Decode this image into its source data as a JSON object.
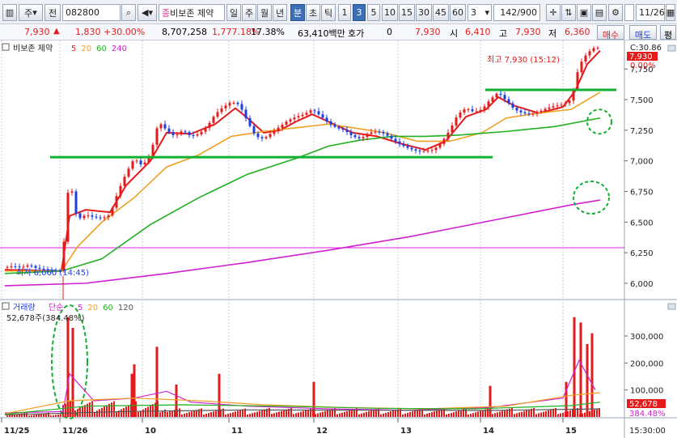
{
  "toolbar": {
    "market_label": "주",
    "period_label": "전",
    "code": "082800",
    "stock_name": "비보존 제약",
    "stock_badge": "종",
    "periods": [
      "일",
      "주",
      "월",
      "년",
      "분",
      "초",
      "틱"
    ],
    "selected_period": "분",
    "intervals": [
      "1",
      "3",
      "5",
      "10",
      "15",
      "30",
      "45",
      "60"
    ],
    "selected_interval": "3",
    "interval_select": "3",
    "count": "142",
    "count_total": "/900",
    "date": "11/26"
  },
  "quote": {
    "price": "7,930",
    "change": "1,830",
    "change_pct": "+30.00%",
    "volume": "8,707,258",
    "volume_pct": "1,777.18%",
    "turnover": "17.38%",
    "amount": "63,410백만",
    "hoga_label": "호가",
    "hoga_value": "0",
    "hoga_price": "7,930",
    "open_label": "시",
    "open": "6,410",
    "high_label": "고",
    "high": "7,930",
    "low_label": "저",
    "low": "6,360",
    "buy_button": "매수",
    "sell_button": "매도",
    "eval_button": "평"
  },
  "chart_data": {
    "type": "candlestick",
    "price_panel": {
      "title": "비보존 제약",
      "ma_labels": [
        {
          "label": "5",
          "color": "#e51b1b"
        },
        {
          "label": "20",
          "color": "#f0a020"
        },
        {
          "label": "60",
          "color": "#20b020"
        },
        {
          "label": "240",
          "color": "#d020d0"
        }
      ],
      "ylim": [
        5900,
        7950
      ],
      "y_ticks": [
        6000,
        6250,
        6500,
        6750,
        7000,
        7250,
        7500,
        7750
      ],
      "y_tick_labels": [
        "6,000",
        "6,250",
        "6,500",
        "6,750",
        "7,000",
        "7,250",
        "7,500",
        "7,750"
      ],
      "top_right_label": "C:30.86",
      "current_price_label": "7,930",
      "current_pct_label": "0.00%",
      "high_annotation": "최고 7,930 (15:12)",
      "low_annotation": "최저 6,060 (14:45)",
      "support_line_1": 7030,
      "support_line_2": 7580,
      "reference_line": 6290
    },
    "volume_panel": {
      "title": "거래량",
      "unit_label": "단순",
      "ma_labels": [
        {
          "label": "5",
          "color": "#d020d0"
        },
        {
          "label": "20",
          "color": "#f0a020"
        },
        {
          "label": "60",
          "color": "#20b020"
        },
        {
          "label": "120",
          "color": "#555555"
        }
      ],
      "info": "52,678주(384.48%)",
      "ylim": [
        0,
        390000
      ],
      "y_ticks": [
        100000,
        200000,
        300000
      ],
      "y_tick_labels": [
        "100,000",
        "200,000",
        "300,000"
      ],
      "current_volume_label": "52,678",
      "current_pct_label": "384.48%"
    },
    "x_labels": [
      "11/25",
      "11/26",
      "10",
      "11",
      "12",
      "13",
      "14",
      "15"
    ],
    "time_label": "15:30:00",
    "price_path": [
      [
        0,
        6130
      ],
      [
        10,
        6140
      ],
      [
        20,
        6130
      ],
      [
        30,
        6150
      ],
      [
        40,
        6120
      ],
      [
        55,
        6110
      ],
      [
        70,
        6100
      ],
      [
        80,
        6900
      ],
      [
        85,
        6650
      ],
      [
        90,
        6520
      ],
      [
        100,
        6560
      ],
      [
        110,
        6540
      ],
      [
        120,
        6530
      ],
      [
        130,
        6560
      ],
      [
        140,
        6750
      ],
      [
        150,
        6900
      ],
      [
        160,
        7020
      ],
      [
        170,
        6960
      ],
      [
        180,
        7050
      ],
      [
        190,
        7320
      ],
      [
        200,
        7250
      ],
      [
        210,
        7200
      ],
      [
        220,
        7250
      ],
      [
        230,
        7200
      ],
      [
        240,
        7220
      ],
      [
        250,
        7280
      ],
      [
        260,
        7380
      ],
      [
        270,
        7440
      ],
      [
        280,
        7480
      ],
      [
        290,
        7460
      ],
      [
        300,
        7320
      ],
      [
        310,
        7200
      ],
      [
        320,
        7180
      ],
      [
        330,
        7230
      ],
      [
        340,
        7280
      ],
      [
        350,
        7330
      ],
      [
        360,
        7360
      ],
      [
        370,
        7380
      ],
      [
        380,
        7420
      ],
      [
        390,
        7370
      ],
      [
        400,
        7310
      ],
      [
        410,
        7270
      ],
      [
        420,
        7250
      ],
      [
        430,
        7200
      ],
      [
        440,
        7180
      ],
      [
        450,
        7230
      ],
      [
        460,
        7240
      ],
      [
        470,
        7220
      ],
      [
        480,
        7170
      ],
      [
        490,
        7130
      ],
      [
        500,
        7100
      ],
      [
        510,
        7080
      ],
      [
        520,
        7080
      ],
      [
        530,
        7090
      ],
      [
        540,
        7150
      ],
      [
        550,
        7250
      ],
      [
        560,
        7380
      ],
      [
        570,
        7430
      ],
      [
        580,
        7400
      ],
      [
        590,
        7420
      ],
      [
        600,
        7500
      ],
      [
        610,
        7560
      ],
      [
        620,
        7490
      ],
      [
        630,
        7420
      ],
      [
        640,
        7390
      ],
      [
        650,
        7380
      ],
      [
        660,
        7400
      ],
      [
        670,
        7430
      ],
      [
        680,
        7450
      ],
      [
        690,
        7460
      ],
      [
        700,
        7500
      ],
      [
        710,
        7780
      ],
      [
        720,
        7880
      ],
      [
        730,
        7930
      ],
      [
        736,
        7920
      ]
    ],
    "ma5": [
      [
        0,
        6110
      ],
      [
        70,
        6100
      ],
      [
        80,
        6550
      ],
      [
        100,
        6600
      ],
      [
        130,
        6580
      ],
      [
        150,
        6800
      ],
      [
        180,
        7000
      ],
      [
        200,
        7230
      ],
      [
        230,
        7220
      ],
      [
        260,
        7300
      ],
      [
        285,
        7430
      ],
      [
        300,
        7350
      ],
      [
        320,
        7230
      ],
      [
        340,
        7250
      ],
      [
        360,
        7320
      ],
      [
        380,
        7380
      ],
      [
        400,
        7320
      ],
      [
        430,
        7230
      ],
      [
        460,
        7200
      ],
      [
        490,
        7140
      ],
      [
        520,
        7090
      ],
      [
        545,
        7160
      ],
      [
        570,
        7360
      ],
      [
        595,
        7420
      ],
      [
        610,
        7520
      ],
      [
        630,
        7450
      ],
      [
        660,
        7390
      ],
      [
        690,
        7440
      ],
      [
        705,
        7570
      ],
      [
        720,
        7790
      ],
      [
        736,
        7900
      ]
    ],
    "ma20": [
      [
        0,
        6100
      ],
      [
        70,
        6100
      ],
      [
        90,
        6300
      ],
      [
        120,
        6500
      ],
      [
        160,
        6700
      ],
      [
        200,
        6950
      ],
      [
        240,
        7050
      ],
      [
        280,
        7200
      ],
      [
        320,
        7240
      ],
      [
        360,
        7270
      ],
      [
        400,
        7300
      ],
      [
        430,
        7270
      ],
      [
        470,
        7230
      ],
      [
        510,
        7160
      ],
      [
        550,
        7160
      ],
      [
        590,
        7230
      ],
      [
        620,
        7350
      ],
      [
        660,
        7390
      ],
      [
        700,
        7420
      ],
      [
        736,
        7560
      ]
    ],
    "ma60": [
      [
        0,
        6080
      ],
      [
        70,
        6100
      ],
      [
        120,
        6200
      ],
      [
        180,
        6480
      ],
      [
        240,
        6700
      ],
      [
        300,
        6890
      ],
      [
        360,
        7020
      ],
      [
        400,
        7120
      ],
      [
        440,
        7170
      ],
      [
        480,
        7200
      ],
      [
        520,
        7200
      ],
      [
        560,
        7210
      ],
      [
        620,
        7240
      ],
      [
        680,
        7280
      ],
      [
        736,
        7350
      ]
    ],
    "ma240": [
      [
        0,
        5980
      ],
      [
        100,
        6000
      ],
      [
        200,
        6080
      ],
      [
        300,
        6170
      ],
      [
        400,
        6270
      ],
      [
        500,
        6380
      ],
      [
        600,
        6510
      ],
      [
        700,
        6640
      ],
      [
        736,
        6680
      ]
    ],
    "volume_highlights": [
      [
        78,
        370000
      ],
      [
        84,
        330000
      ],
      [
        157,
        160000
      ],
      [
        160,
        195000
      ],
      [
        188,
        260000
      ],
      [
        212,
        120000
      ],
      [
        265,
        160000
      ],
      [
        382,
        130000
      ],
      [
        600,
        115000
      ],
      [
        694,
        130000
      ],
      [
        704,
        370000
      ],
      [
        712,
        350000
      ],
      [
        720,
        270000
      ],
      [
        726,
        310000
      ]
    ]
  }
}
